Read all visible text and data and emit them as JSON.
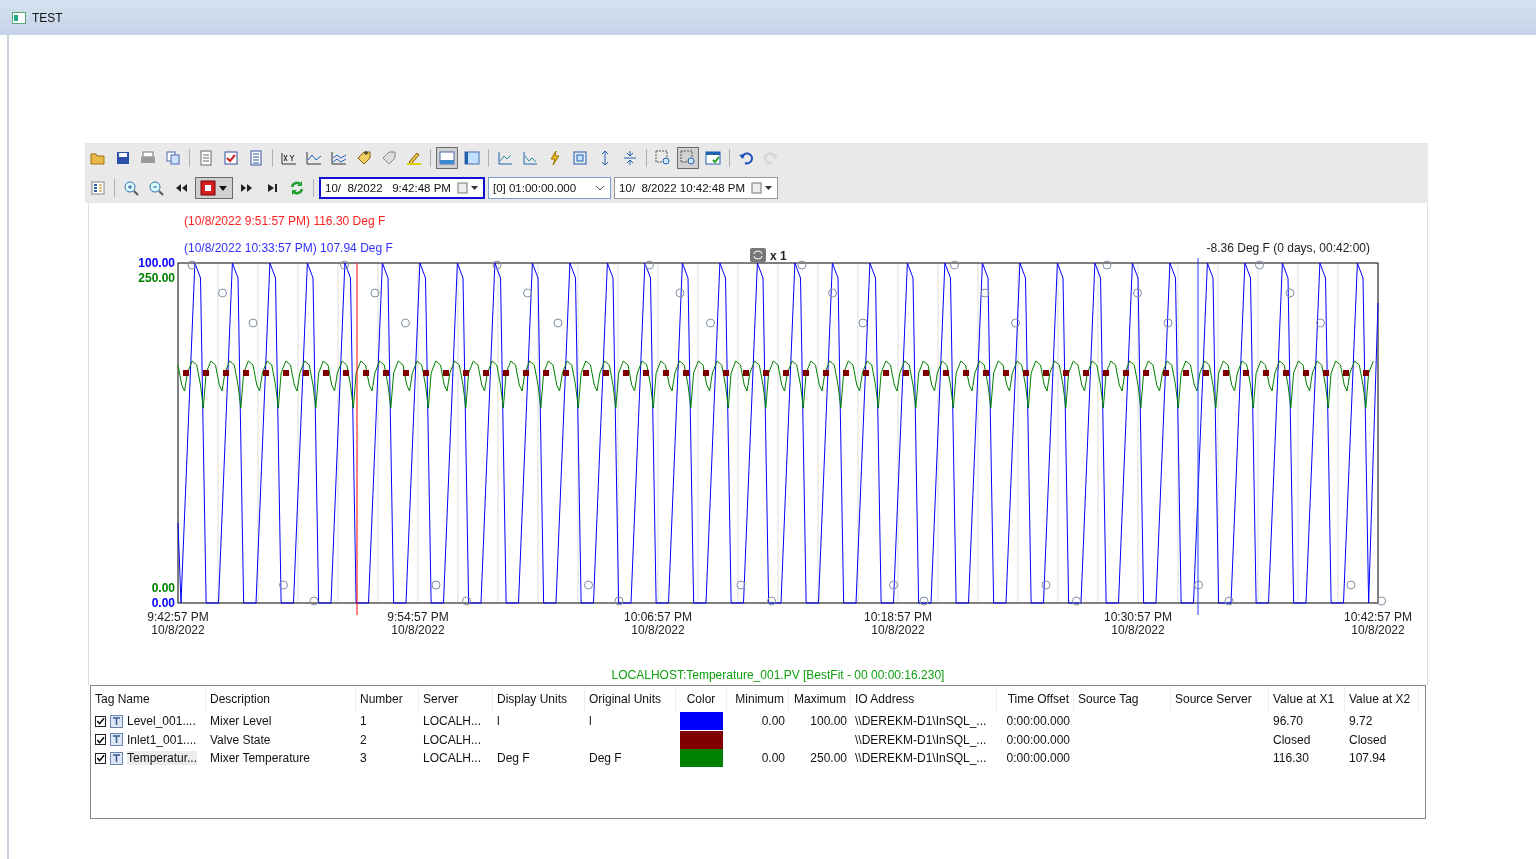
{
  "window": {
    "title": "TEST"
  },
  "toolbar": {
    "groups": [
      [
        {
          "kind": "folder",
          "selected": false,
          "disabled": false
        },
        {
          "kind": "save",
          "selected": false,
          "disabled": false
        },
        {
          "kind": "print",
          "selected": false,
          "disabled": false
        },
        {
          "kind": "copy",
          "selected": false,
          "disabled": false
        }
      ],
      [
        {
          "kind": "doc",
          "selected": false,
          "disabled": false
        },
        {
          "kind": "check",
          "selected": false,
          "disabled": false
        },
        {
          "kind": "list",
          "selected": false,
          "disabled": false
        }
      ],
      [
        {
          "kind": "xy",
          "selected": false,
          "disabled": false
        },
        {
          "kind": "line",
          "selected": false,
          "disabled": false
        },
        {
          "kind": "multiline",
          "selected": false,
          "disabled": false
        },
        {
          "kind": "tagadd",
          "selected": false,
          "disabled": false
        },
        {
          "kind": "tagremove",
          "selected": false,
          "disabled": false
        },
        {
          "kind": "pen",
          "selected": false,
          "disabled": false
        }
      ],
      [
        {
          "kind": "bottombar",
          "selected": true,
          "disabled": false
        },
        {
          "kind": "leftbar",
          "selected": false,
          "disabled": false
        }
      ],
      [
        {
          "kind": "axisup",
          "selected": false,
          "disabled": false
        },
        {
          "kind": "axisdown",
          "selected": false,
          "disabled": false
        },
        {
          "kind": "bolt",
          "selected": false,
          "disabled": false
        },
        {
          "kind": "fit",
          "selected": false,
          "disabled": false
        },
        {
          "kind": "expand",
          "selected": false,
          "disabled": false
        },
        {
          "kind": "compress",
          "selected": false,
          "disabled": false
        }
      ],
      [
        {
          "kind": "zoombox",
          "selected": false,
          "disabled": false
        },
        {
          "kind": "zoomboxon",
          "selected": true,
          "disabled": false
        },
        {
          "kind": "windowcheck",
          "selected": false,
          "disabled": false
        }
      ],
      [
        {
          "kind": "undo",
          "selected": false,
          "disabled": false
        },
        {
          "kind": "redo",
          "selected": false,
          "disabled": true
        }
      ]
    ],
    "groups2": [
      [
        {
          "kind": "legend",
          "selected": false,
          "disabled": false
        }
      ],
      [
        {
          "kind": "zoomin",
          "selected": false,
          "disabled": false
        },
        {
          "kind": "zoomout",
          "selected": false,
          "disabled": false
        },
        {
          "kind": "rewind",
          "selected": false,
          "disabled": false
        },
        {
          "kind": "stop",
          "selected": true,
          "disabled": false
        },
        {
          "kind": "forward",
          "selected": false,
          "disabled": false
        },
        {
          "kind": "end",
          "selected": false,
          "disabled": false
        },
        {
          "kind": "refresh",
          "selected": false,
          "disabled": false
        }
      ]
    ],
    "start_time": {
      "value": "10/  8/2022   9:42:48 PM",
      "selected": true
    },
    "duration": {
      "value": "[0] 01:00:00.000"
    },
    "end_time": {
      "value": "10/  8/2022 10:42:48 PM",
      "selected": false
    }
  },
  "chart": {
    "cursor1_label": "(10/8/2022 9:51:57 PM) 116.30 Deg F",
    "cursor2_label": "(10/8/2022 10:33:57 PM) 107.94 Deg F",
    "zoom_level": "x 1",
    "delta_label": "-8.36 Deg F (0 days, 00:42:00)",
    "y_labels": [
      {
        "text": "100.00",
        "color": "#0000ff"
      },
      {
        "text": "250.00",
        "color": "#008000"
      },
      {
        "text": "0.00",
        "color": "#008000"
      },
      {
        "text": "0.00",
        "color": "#0000ff"
      }
    ],
    "x_ticks": [
      {
        "time": "9:42:57 PM",
        "date": "10/8/2022"
      },
      {
        "time": "9:54:57 PM",
        "date": "10/8/2022"
      },
      {
        "time": "10:06:57 PM",
        "date": "10/8/2022"
      },
      {
        "time": "10:18:57 PM",
        "date": "10/8/2022"
      },
      {
        "time": "10:30:57 PM",
        "date": "10/8/2022"
      },
      {
        "time": "10:42:57 PM",
        "date": "10/8/2022"
      }
    ],
    "legend": "LOCALHOST:Temperature_001.PV [BestFit - 00 00:00:16.230]"
  },
  "table": {
    "columns": [
      "Tag Name",
      "Description",
      "Number",
      "Server",
      "Display Units",
      "Original Units",
      "Color",
      "Minimum",
      "Maximum",
      "IO Address",
      "Time Offset",
      "Source Tag",
      "Source Server",
      "Value at X1",
      "Value at X2"
    ],
    "rows": [
      {
        "checked": true,
        "selected": false,
        "tag_name": "Level_001....",
        "description": "Mixer Level",
        "number": "1",
        "server": "LOCALH...",
        "display_units": "l",
        "original_units": "l",
        "color": "#0000ff",
        "minimum": "0.00",
        "maximum": "100.00",
        "io_address": "\\\\DEREKM-D1\\InSQL_...",
        "time_offset": "0:00:00.000",
        "value_x1": "96.70",
        "value_x2": "9.72"
      },
      {
        "checked": true,
        "selected": false,
        "tag_name": "Inlet1_001....",
        "description": "Valve State",
        "number": "2",
        "server": "LOCALH...",
        "color": "#800000",
        "io_address": "\\\\DEREKM-D1\\InSQL_...",
        "time_offset": "0:00:00.000",
        "value_x1": "Closed",
        "value_x2": "Closed"
      },
      {
        "checked": true,
        "selected": true,
        "tag_name": "Temperatur...",
        "description": "Mixer Temperature",
        "number": "3",
        "server": "LOCALH...",
        "display_units": "Deg F",
        "original_units": "Deg F",
        "color": "#008000",
        "minimum": "0.00",
        "maximum": "250.00",
        "io_address": "\\\\DEREKM-D1\\InSQL_...",
        "time_offset": "0:00:00.000",
        "value_x1": "116.30",
        "value_x2": "107.94"
      }
    ]
  }
}
